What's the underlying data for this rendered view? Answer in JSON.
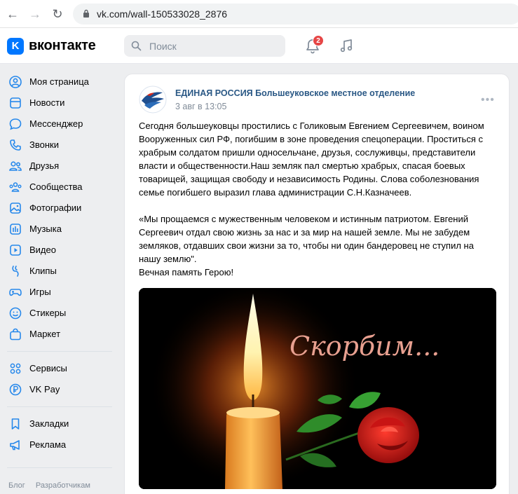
{
  "browser": {
    "url": "vk.com/wall-150533028_2876"
  },
  "header": {
    "brand": "вконтакте",
    "logo_letter": "K",
    "search_placeholder": "Поиск",
    "notifications_count": "2"
  },
  "sidebar": {
    "items": [
      {
        "label": "Моя страница",
        "icon": "user-circle-icon"
      },
      {
        "label": "Новости",
        "icon": "news-icon"
      },
      {
        "label": "Мессенджер",
        "icon": "message-icon"
      },
      {
        "label": "Звонки",
        "icon": "phone-icon"
      },
      {
        "label": "Друзья",
        "icon": "friends-icon"
      },
      {
        "label": "Сообщества",
        "icon": "communities-icon"
      },
      {
        "label": "Фотографии",
        "icon": "photo-icon"
      },
      {
        "label": "Музыка",
        "icon": "music-icon"
      },
      {
        "label": "Видео",
        "icon": "video-icon"
      },
      {
        "label": "Клипы",
        "icon": "clips-icon"
      },
      {
        "label": "Игры",
        "icon": "games-icon"
      },
      {
        "label": "Стикеры",
        "icon": "stickers-icon"
      },
      {
        "label": "Маркет",
        "icon": "market-icon"
      },
      {
        "label": "Сервисы",
        "icon": "services-icon"
      },
      {
        "label": "VK Pay",
        "icon": "vkpay-icon"
      },
      {
        "label": "Закладки",
        "icon": "bookmark-icon"
      },
      {
        "label": "Реклама",
        "icon": "ads-icon"
      }
    ],
    "footer": [
      "Блог",
      "Разработчикам"
    ]
  },
  "post": {
    "author": "ЕДИНАЯ РОССИЯ Большеуковское местное отделение",
    "date": "3 авг в 13:05",
    "paragraphs": [
      "Сегодня большеуковцы простились с Голиковым Евгением Сергеевичем, воином Вооруженных сил РФ, погибшим в зоне проведения спецоперации. Проститься с храбрым солдатом пришли односельчане, друзья, сослуживцы, представители власти и общественности.Наш земляк пал смертью храбрых, спасая боевых товарищей, защищая свободу и независимость Родины. Слова соболезнования семье погибшего выразил глава администрации С.Н.Казначеев.",
      "«Мы прощаемся с мужественным человеком и истинным патриотом. Евгений Сергеевич отдал свою жизнь за нас и за мир на нашей земле. Мы не забудем земляков, отдавших свои жизни за то, чтобы ни один бандеровец не ступил на нашу землю\".",
      "Вечная память Герою!"
    ],
    "image_caption": "Скорбим..."
  },
  "colors": {
    "vk_blue": "#0077ff",
    "link": "#2a5885",
    "badge": "#e64646",
    "caption": "#e8a090"
  }
}
